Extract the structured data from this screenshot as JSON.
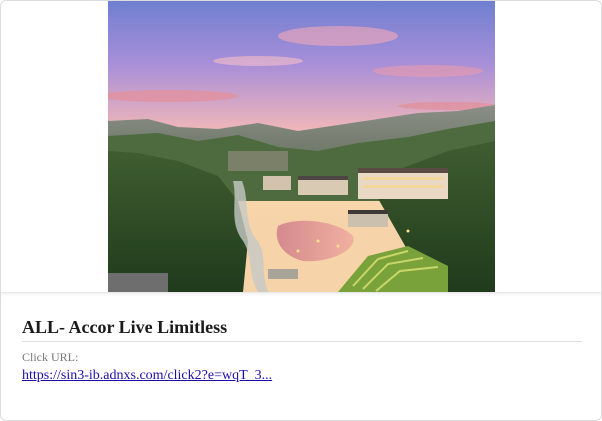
{
  "ad": {
    "title": "ALL- Accor Live Limitless",
    "click_label": "Click URL:",
    "click_url": "https://sin3-ib.adnxs.com/click2?e=wqT_3..."
  },
  "image": {
    "subject": "aerial-resort-at-sunset"
  },
  "colors": {
    "link": "#1a0dab",
    "title": "#1a1a1a",
    "label": "#777777",
    "border": "#dcdcdc"
  }
}
